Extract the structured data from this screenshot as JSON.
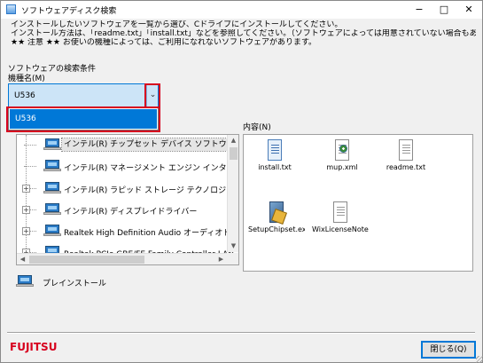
{
  "window": {
    "title": "ソフトウェアディスク検索",
    "controls": {
      "minimize": "−",
      "maximize": "□",
      "close": "✕"
    }
  },
  "notes": [
    "インストールしたいソフトウェアを一覧から選び、Cドライブにインストールしてください。",
    "インストール方法は、「readme.txt」「install.txt」などを参照してください。（ソフトウェアによっては用意されていない場合もあります）",
    "★★ 注意 ★★ お使いの機種によっては、ご利用になれないソフトウェアがあります。"
  ],
  "search_conditions_label": "ソフトウェアの検索条件",
  "model": {
    "label": "機種名(M)",
    "selected_value": "U536",
    "dropdown_button": "⌄",
    "options": [
      "U536"
    ]
  },
  "tree": {
    "items": [
      {
        "label": "インテル(R) チップセット デバイス ソフトウェア",
        "expandable": false,
        "selected": true
      },
      {
        "label": "インテル(R) マネージメント エンジン インターフェイス",
        "expandable": false,
        "selected": false
      },
      {
        "label": "インテル(R) ラピッド ストレージ テクノロジー",
        "expandable": true,
        "selected": false
      },
      {
        "label": "インテル(R) ディスプレイドライバー",
        "expandable": true,
        "selected": false
      },
      {
        "label": "Realtek High Definition Audio オーディオドライバ",
        "expandable": true,
        "selected": false
      },
      {
        "label": "Realtek PCIe GBE/FE Family Controller LAN ドライバ",
        "expandable": true,
        "selected": false
      }
    ],
    "expander_symbol": "+",
    "scroll": {
      "up": "▲",
      "down": "▼",
      "left": "◀",
      "right": "▶"
    }
  },
  "content": {
    "label": "内容(N)",
    "files": [
      {
        "name": "install.txt",
        "icon": "text-file-icon"
      },
      {
        "name": "mup.xml",
        "icon": "xml-file-icon"
      },
      {
        "name": "readme.txt",
        "icon": "text-file-icon"
      },
      {
        "name": "SetupChipset.exe",
        "icon": "setup-exe-icon"
      },
      {
        "name": "WixLicenseNote.t...",
        "icon": "text-file-icon"
      }
    ]
  },
  "preinstall_label": "プレインストール",
  "brand": "FUJITSU",
  "close_button": "閉じる(Q)",
  "colors": {
    "accent": "#0078d7",
    "highlight_box": "#d7001e",
    "brand_red": "#d7001e",
    "combo_bg": "#cce4f7"
  }
}
